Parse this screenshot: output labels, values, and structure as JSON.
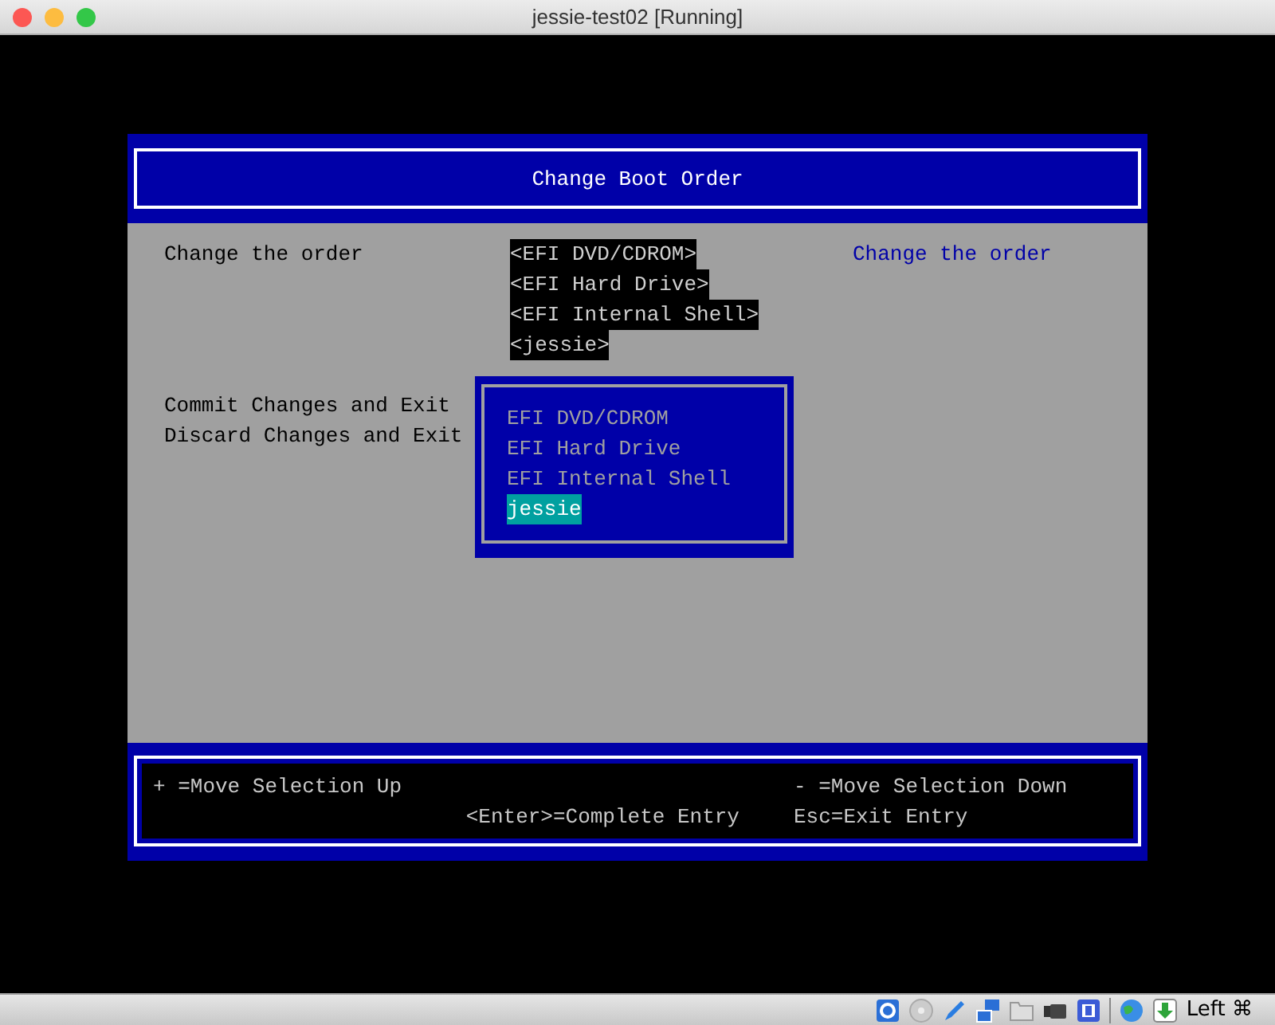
{
  "window": {
    "title": "jessie-test02 [Running]"
  },
  "dialog": {
    "title": "Change Boot Order",
    "label": "Change the order",
    "order": [
      "<EFI DVD/CDROM>",
      "<EFI Hard Drive>",
      "<EFI Internal Shell>",
      "<jessie>"
    ],
    "help": "Change the order",
    "actions": [
      "Commit Changes and Exit",
      "Discard Changes and Exit"
    ],
    "popup": {
      "items": [
        {
          "label": "EFI DVD/CDROM",
          "selected": false
        },
        {
          "label": "EFI Hard Drive",
          "selected": false
        },
        {
          "label": "EFI Internal Shell",
          "selected": false
        },
        {
          "label": "jessie",
          "selected": true
        }
      ]
    }
  },
  "footer": {
    "keys": [
      {
        "text": "+ =Move Selection Up",
        "kind": "left"
      },
      {
        "text": "- =Move Selection Down",
        "kind": "left"
      },
      {
        "text": "<Enter>=Complete Entry",
        "kind": "right"
      },
      {
        "text": "Esc=Exit Entry",
        "kind": "left"
      }
    ]
  },
  "status_bar": {
    "host_key": "Left ⌘"
  }
}
